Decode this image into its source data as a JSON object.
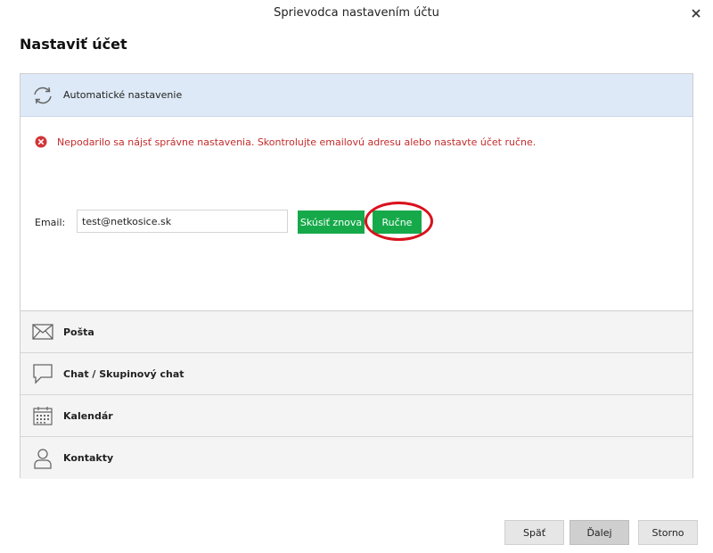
{
  "window": {
    "title": "Sprievodca nastavením účtu"
  },
  "page": {
    "title": "Nastaviť účet"
  },
  "auto_setup": {
    "label": "Automatické nastavenie",
    "error_message": "Nepodarilo sa nájsť správne nastavenia. Skontrolujte emailovú adresu alebo nastavte účet ručne.",
    "email_label": "Email:",
    "email_value": "test@netkosice.sk",
    "retry_label": "Skúsiť znova",
    "manual_label": "Ručne"
  },
  "sections": [
    {
      "label": "Pošta",
      "icon": "mail-icon"
    },
    {
      "label": "Chat / Skupinový chat",
      "icon": "chat-icon"
    },
    {
      "label": "Kalendár",
      "icon": "calendar-icon"
    },
    {
      "label": "Kontakty",
      "icon": "contact-icon"
    }
  ],
  "footer": {
    "back_label": "Späť",
    "next_label": "Ďalej",
    "cancel_label": "Storno"
  },
  "colors": {
    "accent_green": "#16a94a",
    "error_red": "#c42b2b",
    "highlight_blue": "#dde9f7",
    "annotation_red": "#d9111c"
  }
}
